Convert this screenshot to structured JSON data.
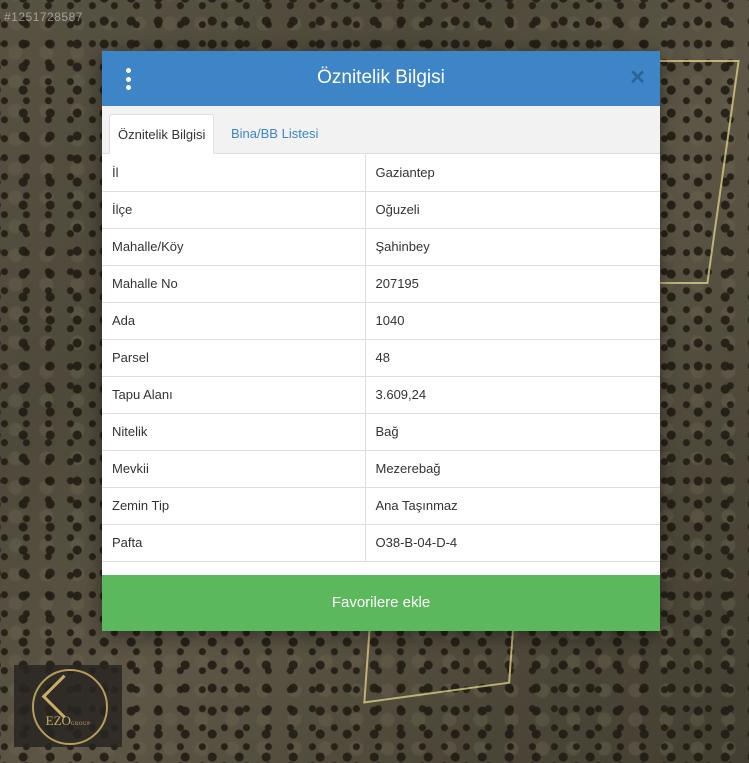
{
  "background": {
    "watermark_id": "#1251728587",
    "logo_text": "EZO",
    "logo_subtext": "GROUP"
  },
  "modal": {
    "title": "Öznitelik Bilgisi",
    "tabs": [
      {
        "label": "Öznitelik Bilgisi",
        "active": true
      },
      {
        "label": "Bina/BB Listesi",
        "active": false
      }
    ],
    "rows": [
      {
        "key": "İl",
        "value": "Gaziantep"
      },
      {
        "key": "İlçe",
        "value": "Oğuzeli"
      },
      {
        "key": "Mahalle/Köy",
        "value": "Şahinbey"
      },
      {
        "key": "Mahalle No",
        "value": "207195"
      },
      {
        "key": "Ada",
        "value": "1040"
      },
      {
        "key": "Parsel",
        "value": "48"
      },
      {
        "key": "Tapu Alanı",
        "value": "3.609,24"
      },
      {
        "key": "Nitelik",
        "value": "Bağ"
      },
      {
        "key": "Mevkii",
        "value": "Mezerebağ"
      },
      {
        "key": "Zemin Tip",
        "value": "Ana Taşınmaz"
      },
      {
        "key": "Pafta",
        "value": "O38-B-04-D-4"
      }
    ],
    "favorite_button_label": "Favorilere ekle",
    "icons": {
      "menu": "vertical-dots-icon",
      "close": "close-icon"
    },
    "colors": {
      "header": "#3d85c6",
      "button": "#5cb85c",
      "tab_link": "#3d85c6"
    }
  }
}
